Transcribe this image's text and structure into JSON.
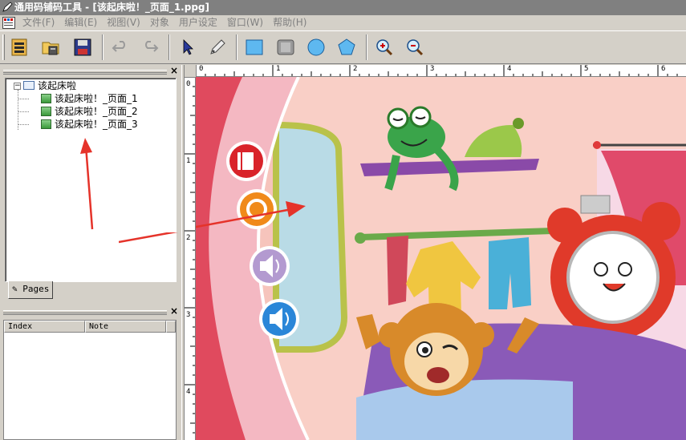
{
  "window": {
    "title": "通用码铺码工具 - [该起床啦！_页面_1.ppg]"
  },
  "menu": {
    "items": [
      "文件(F)",
      "编辑(E)",
      "视图(V)",
      "对象",
      "用户设定",
      "窗口(W)",
      "帮助(H)"
    ]
  },
  "toolbar": {
    "buttons": [
      {
        "name": "book-list-icon"
      },
      {
        "name": "open-folder-icon"
      },
      {
        "name": "save-disk-icon"
      },
      {
        "name": "undo-icon"
      },
      {
        "name": "redo-icon"
      },
      {
        "name": "pointer-arrow-icon"
      },
      {
        "name": "pen-tool-icon"
      },
      {
        "name": "rectangle-tool-icon"
      },
      {
        "name": "rounded-rect-tool-icon"
      },
      {
        "name": "circle-tool-icon"
      },
      {
        "name": "polygon-tool-icon"
      },
      {
        "name": "zoom-in-icon"
      },
      {
        "name": "zoom-out-icon"
      }
    ]
  },
  "tree": {
    "root": "该起床啦",
    "pages": [
      "该起床啦！_页面_1",
      "该起床啦！_页面_2",
      "该起床啦！_页面_3"
    ]
  },
  "pages_tab": {
    "label": "Pages"
  },
  "index_panel": {
    "columns": [
      "Index",
      "Note"
    ]
  },
  "rulers": {
    "h_labels": [
      "0",
      "1",
      "2",
      "3",
      "4",
      "5",
      "6"
    ],
    "v_labels": [
      "0",
      "1",
      "2",
      "3",
      "4"
    ]
  },
  "colors": {
    "accent_red": "#e83a2a",
    "selection_blue": "#3b7fd6",
    "annotation_arrow": "#e5332a"
  }
}
